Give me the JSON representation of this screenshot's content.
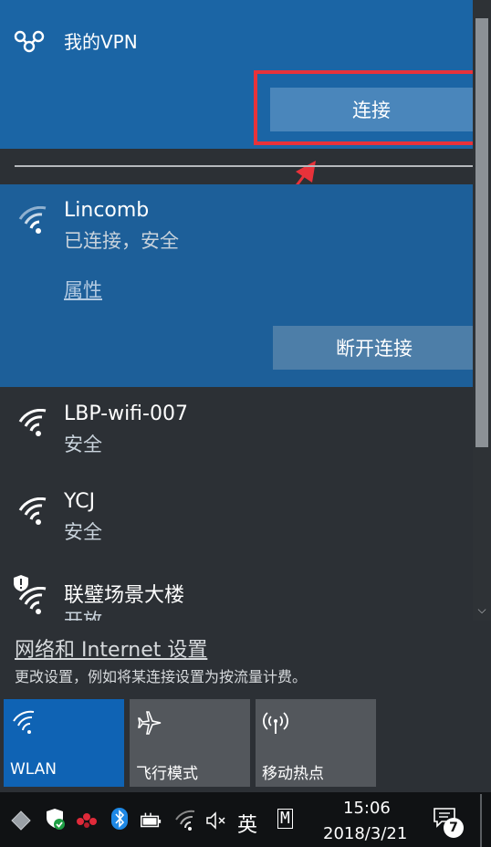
{
  "vpn": {
    "name": "我的VPN",
    "connect_label": "连接"
  },
  "connected_network": {
    "name": "Lincomb",
    "status": "已连接，安全",
    "properties_label": "属性",
    "disconnect_label": "断开连接"
  },
  "networks": [
    {
      "name": "LBP-wifi-007",
      "status": "安全"
    },
    {
      "name": "YCJ",
      "status": "安全"
    },
    {
      "name": "联璧场景大楼",
      "status": "开放"
    }
  ],
  "settings": {
    "link_label": "网络和 Internet 设置",
    "description": "更改设置，例如将某连接设置为按流量计费。"
  },
  "quick_actions": [
    {
      "label": "WLAN",
      "icon": "wifi-icon",
      "active": true
    },
    {
      "label": "飞行模式",
      "icon": "airplane-icon",
      "active": false
    },
    {
      "label": "移动热点",
      "icon": "hotspot-icon",
      "active": false
    }
  ],
  "taskbar": {
    "ime_label": "英",
    "ime_mode": "M",
    "time": "15:06",
    "date": "2018/3/21",
    "notification_count": "7"
  },
  "colors": {
    "accent": "#1b65a5",
    "highlight_box": "#e8323a"
  }
}
